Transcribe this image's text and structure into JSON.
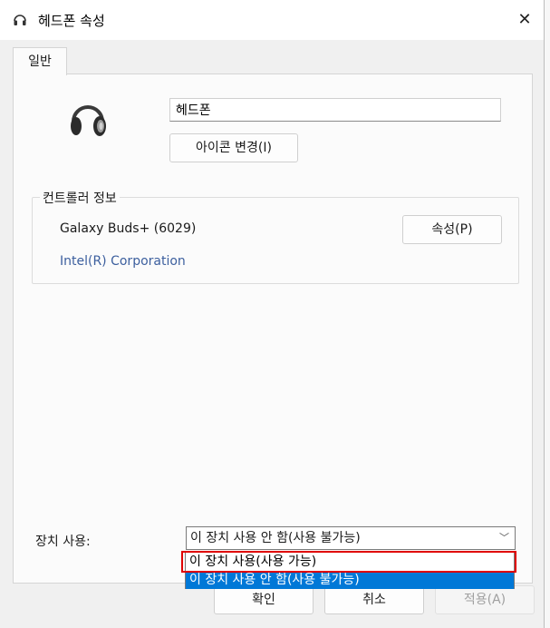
{
  "window": {
    "title": "헤드폰 속성",
    "close_label": "✕"
  },
  "tabs": [
    {
      "label": "일반"
    }
  ],
  "device": {
    "icon": "headphones-icon",
    "name_value": "헤드폰",
    "change_icon_label": "아이콘 변경(I)"
  },
  "controller": {
    "group_label": "컨트롤러 정보",
    "name": "Galaxy Buds+  (6029)",
    "vendor": "Intel(R) Corporation",
    "properties_label": "속성(P)"
  },
  "usage": {
    "label": "장치 사용:",
    "selected": "이 장치 사용 안 함(사용 불가능)",
    "options": [
      "이 장치 사용(사용 가능)",
      "이 장치 사용 안 함(사용 불가능)"
    ]
  },
  "buttons": {
    "ok": "확인",
    "cancel": "취소",
    "apply": "적용(A)"
  },
  "colors": {
    "accent": "#0078d7",
    "highlight_box": "#e00000",
    "vendor_text": "#3c5f9e"
  }
}
